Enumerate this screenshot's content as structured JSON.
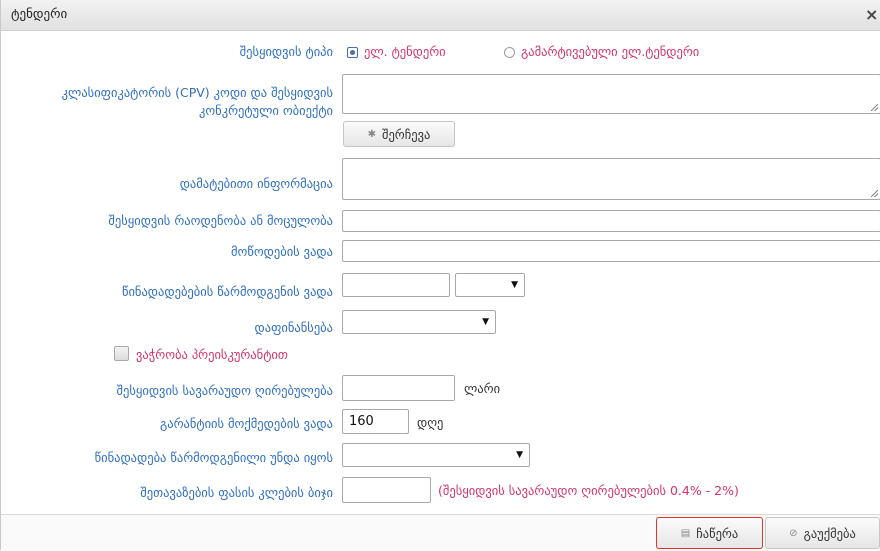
{
  "dialog": {
    "title": "ტენდერი",
    "close_glyph": "×"
  },
  "form": {
    "procurement_type": {
      "label": "შესყიდვის ტიპი",
      "options": [
        {
          "label": "ელ. ტენდერი",
          "selected": true
        },
        {
          "label": "გამარტივებული ელ.ტენდერი",
          "selected": false
        }
      ]
    },
    "cpv_code": {
      "label": "კლასიფიკატორის (CPV) კოდი და შესყიდვის კონკრეტული ობიექტი",
      "value": "",
      "select_button": "შერჩევა"
    },
    "additional_info": {
      "label": "დამატებითი ინფორმაცია",
      "value": ""
    },
    "quantity": {
      "label": "შესყიდვის რაოდენობა ან მოცულობა",
      "value": ""
    },
    "delivery_term": {
      "label": "მოწოდების ვადა",
      "value": ""
    },
    "submission_term": {
      "label": "წინადადებების წარმოდგენის ვადა",
      "value": "",
      "select_value": ""
    },
    "financing": {
      "label": "დაფინანსება",
      "value": ""
    },
    "price_list": {
      "label": "ვაჭრობა პრეისკურანტით",
      "checked": false
    },
    "estimated_value": {
      "label": "შესყიდვის სავარაუდო ღირებულება",
      "value": "",
      "unit": "ლარი"
    },
    "guarantee_term": {
      "label": "გარანტიის მოქმედების ვადა",
      "value": "160",
      "unit": "დღე"
    },
    "proposal_submitted": {
      "label": "წინადადება წარმოდგენილი უნდა იყოს",
      "value": ""
    },
    "price_step": {
      "label": "შეთავაზების ფასის კლების ბიჯი",
      "value": "",
      "note": "(შესყიდვის სავარაუდო ღირებულების 0.4% - 2%)"
    }
  },
  "footer": {
    "save_label": "ჩაწერა",
    "cancel_label": "გაუქმება"
  }
}
